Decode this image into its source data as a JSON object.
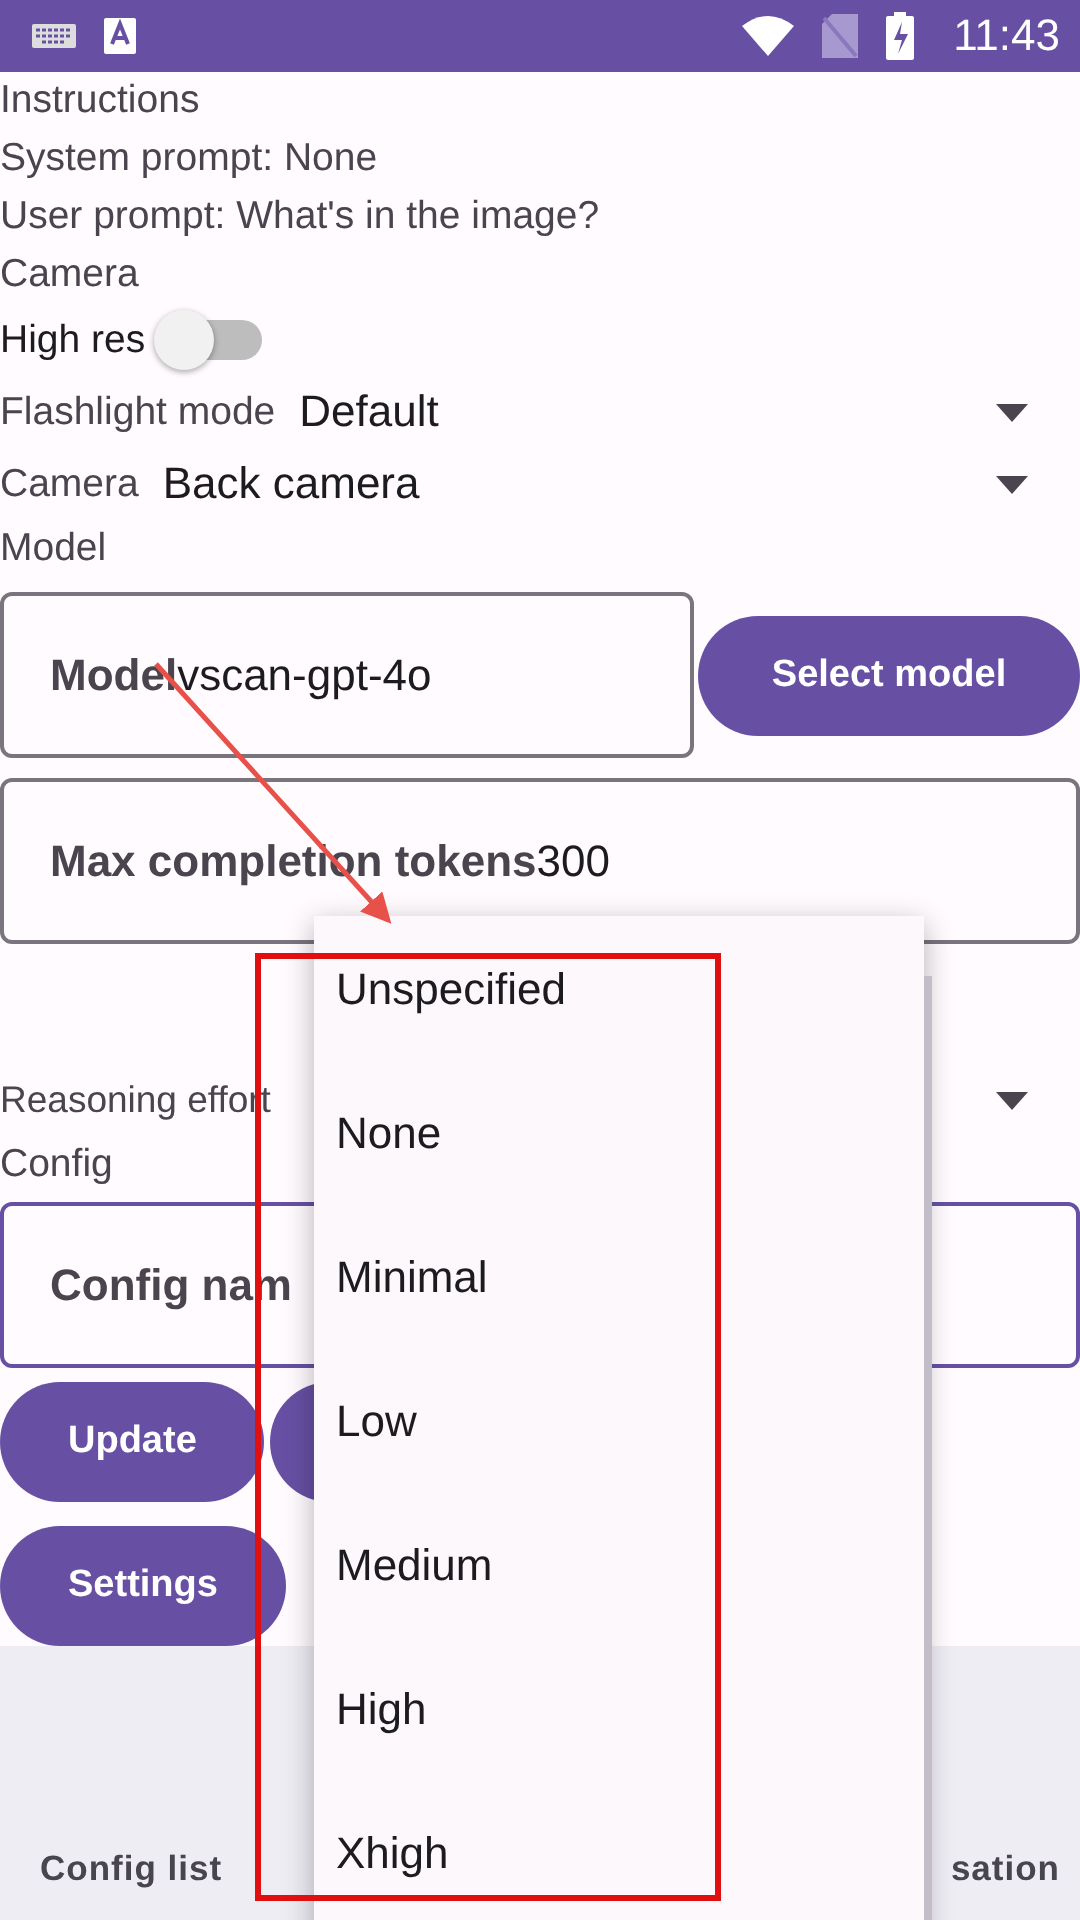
{
  "status_bar": {
    "time": "11:43"
  },
  "instructions": {
    "heading": "Instructions",
    "lines": [
      "System prompt: None",
      "User prompt: What's in the image?"
    ]
  },
  "camera": {
    "heading": "Camera",
    "high_res": {
      "label": "High res",
      "on": false
    },
    "dropdowns": [
      {
        "label": "Flashlight mode",
        "value": "Default"
      },
      {
        "label": "Camera",
        "value": "Back camera"
      }
    ]
  },
  "model": {
    "heading": "Model",
    "model_field": {
      "label": "Model",
      "value": "vscan-gpt-4o"
    },
    "select_button": "Select model",
    "tokens_field": {
      "label": "Max completion tokens",
      "value": "300"
    },
    "reasoning": {
      "label": "Reasoning effort"
    }
  },
  "config": {
    "heading": "Config",
    "name_field": {
      "label": "Config nam"
    },
    "buttons": [
      {
        "kind": "labeled",
        "label": "Update"
      },
      {
        "kind": "covered"
      }
    ],
    "settings_button": "Settings"
  },
  "bottom_nav": [
    {
      "label": "Config list"
    },
    {
      "label": "sation"
    }
  ],
  "menu": {
    "items": [
      {
        "label": "Unspecified"
      },
      {
        "label": "None"
      },
      {
        "label": "Minimal"
      },
      {
        "label": "Low"
      },
      {
        "label": "Medium"
      },
      {
        "label": "High"
      },
      {
        "label": "Xhigh"
      }
    ]
  }
}
